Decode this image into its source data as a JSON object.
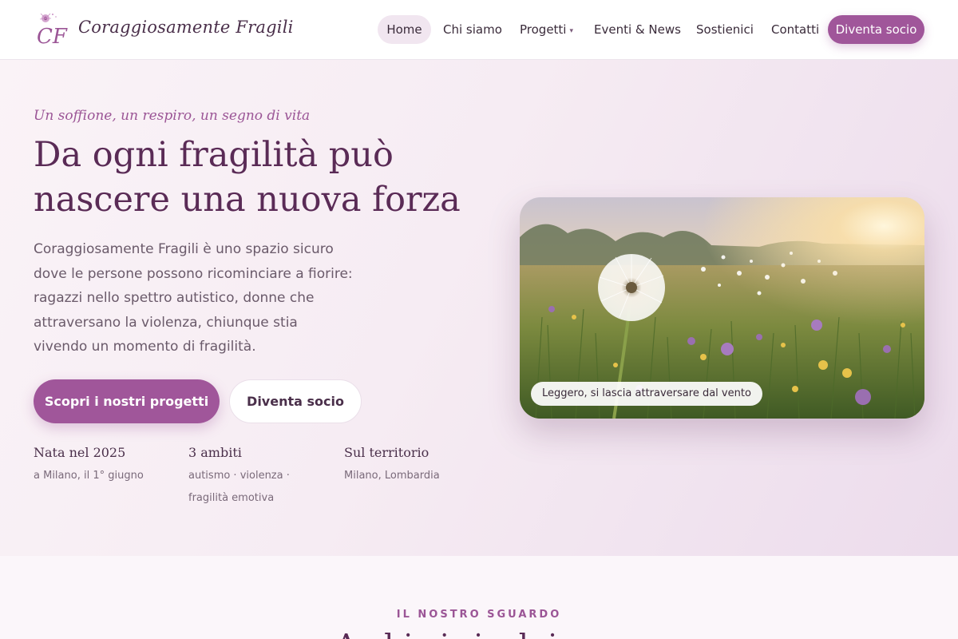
{
  "brand": {
    "name": "Coraggiosamente Fragili",
    "logo_letters": "CF"
  },
  "nav": {
    "items": [
      {
        "label": "Home",
        "active": true
      },
      {
        "label": "Chi siamo"
      },
      {
        "label": "Progetti",
        "has_dropdown": true
      },
      {
        "label": "Eventi & News"
      },
      {
        "label": "Sostienici"
      },
      {
        "label": "Contatti"
      }
    ],
    "cta": "Diventa socio"
  },
  "hero": {
    "eyebrow": "Un soffione, un respiro, un segno di vita",
    "title": "Da ogni fragilità può nascere una nuova forza",
    "lead": "Coraggiosamente Fragili è uno spazio sicuro dove le persone possono ricominciare a fiorire: ragazzi nello spettro autistico, donne che attraversano la violenza, chiunque stia vivendo un momento di fragilità.",
    "primary_button": "Scopri i nostri progetti",
    "secondary_button": "Diventa socio",
    "stats": [
      {
        "title": "Nata nel 2025",
        "sub": "a Milano, il 1° giugno"
      },
      {
        "title": "3 ambiti",
        "sub": "autismo · violenza · fragilità emotiva"
      },
      {
        "title": "Sul territorio",
        "sub": "Milano, Lombardia"
      }
    ],
    "image_caption": "Leggero, si lascia attraversare dal vento"
  },
  "section2": {
    "kicker": "IL NOSTRO SGUARDO",
    "title": "A chi ci rivolgiamo"
  },
  "colors": {
    "accent": "#a0569a",
    "heading": "#5a2b56",
    "hero_bg_start": "#faf3f7",
    "hero_bg_end": "#ecdcec"
  }
}
